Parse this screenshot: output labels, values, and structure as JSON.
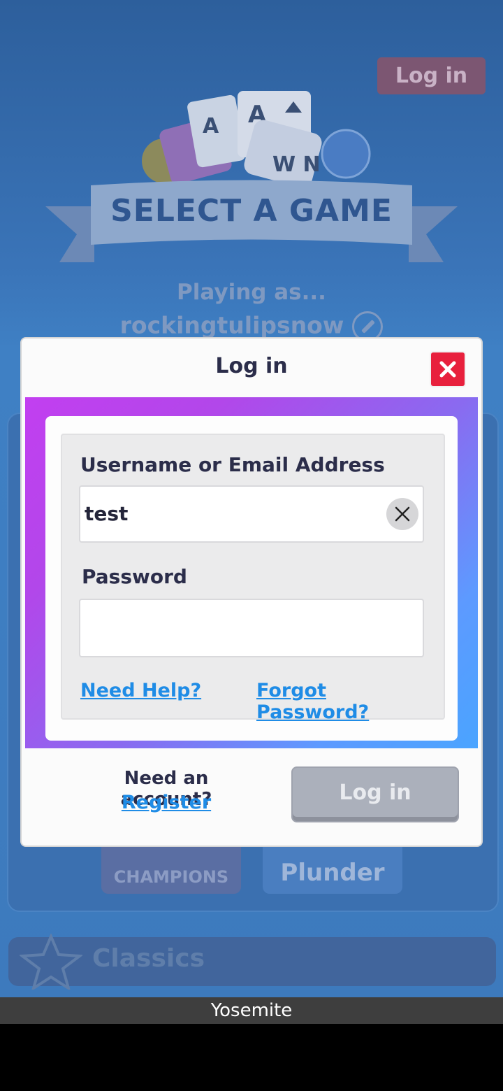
{
  "background": {
    "header_login_label": "Log in",
    "title": "SELECT A GAME",
    "playing_as": "Playing as...",
    "username": "rockingtulipsnow",
    "tile1_label": "CHAMPIONS",
    "tile2_label": "Plunder",
    "classics_label": "Classics"
  },
  "modal": {
    "title": "Log in",
    "username_label": "Username or Email Address",
    "username_value": "test",
    "password_label": "Password",
    "password_value": "",
    "need_help": "Need Help?",
    "forgot_password": "Forgot Password?",
    "need_account": "Need an account?",
    "register": "Register",
    "login_button": "Log in"
  },
  "system_bar": {
    "label": "Yosemite"
  },
  "colors": {
    "close_red": "#e8203d",
    "link_blue": "#1f8ce6",
    "disabled_button": "#abb0bb"
  }
}
